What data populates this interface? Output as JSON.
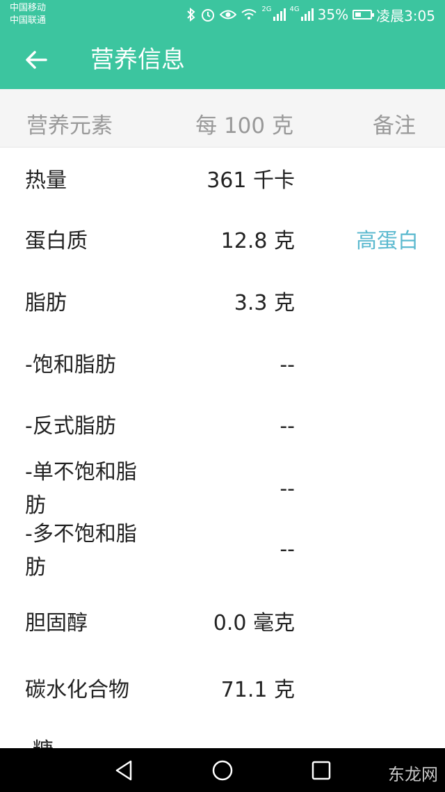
{
  "status_bar": {
    "carrier1": "中国移动",
    "carrier2": "中国联通",
    "net1": "2G",
    "net2": "4G",
    "battery": "35%",
    "time": "凌晨3:05"
  },
  "app_bar": {
    "title": "营养信息",
    "back_icon": "arrow-left-icon"
  },
  "table": {
    "headers": [
      "营养元素",
      "每 100 克",
      "备注"
    ],
    "rows": [
      {
        "name": "热量",
        "value": "361 千卡",
        "note": ""
      },
      {
        "name": "蛋白质",
        "value": "12.8 克",
        "note": "高蛋白"
      },
      {
        "name": "脂肪",
        "value": "3.3 克",
        "note": ""
      },
      {
        "name": "-饱和脂肪",
        "value": "--",
        "note": ""
      },
      {
        "name": "-反式脂肪",
        "value": "--",
        "note": ""
      },
      {
        "name": "-单不饱和脂肪",
        "value": "--",
        "note": ""
      },
      {
        "name": "-多不饱和脂肪",
        "value": "--",
        "note": ""
      },
      {
        "name": "胆固醇",
        "value": "0.0 毫克",
        "note": ""
      },
      {
        "name": "碳水化合物",
        "value": "71.1 克",
        "note": ""
      },
      {
        "name": "-糖",
        "value": "",
        "note": ""
      }
    ]
  },
  "nav_bar": {
    "back": "triangle-back-icon",
    "home": "circle-home-icon",
    "recent": "square-recent-icon"
  },
  "watermark": "东龙网"
}
